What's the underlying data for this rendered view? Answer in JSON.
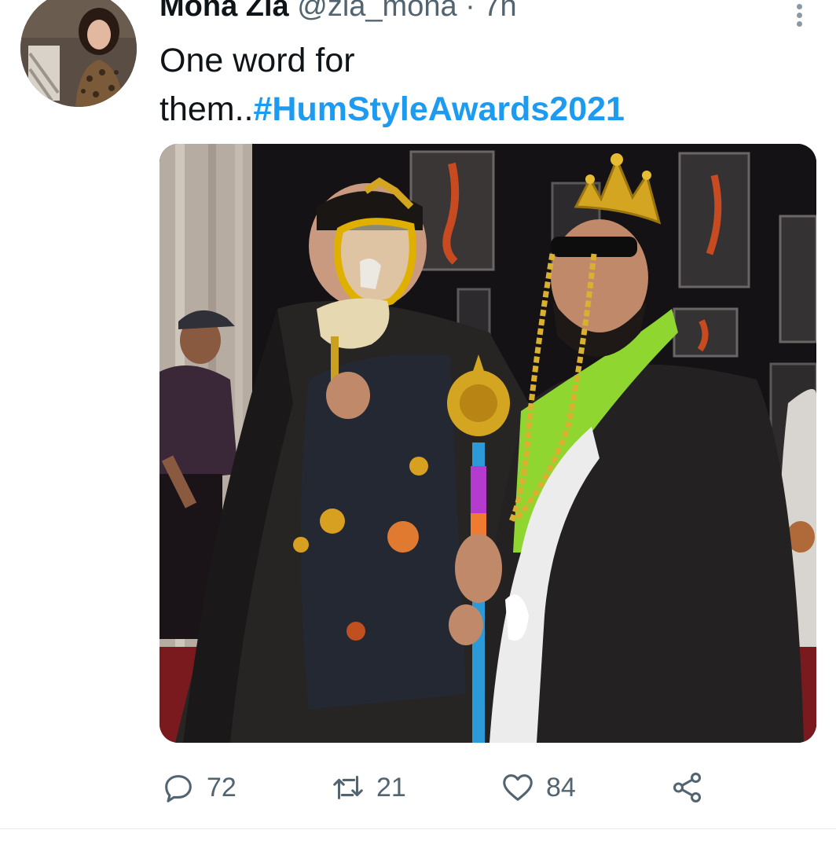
{
  "tweet": {
    "author": {
      "display_name": "Mona Zia",
      "handle": "@zia_mona",
      "separator": "·",
      "time": "7h"
    },
    "text": {
      "body": "One word for them..",
      "hashtag": "#HumStyleAwards2021"
    },
    "icons": {
      "more": "more-vertical-icon",
      "reply": "reply-icon",
      "retweet": "retweet-icon",
      "like": "heart-icon",
      "share": "share-icon"
    },
    "actions": {
      "reply_count": "72",
      "retweet_count": "21",
      "like_count": "84"
    },
    "colors": {
      "hashtag": "#1d9bf0",
      "secondary_text": "#536471",
      "icon": "#536471"
    }
  }
}
